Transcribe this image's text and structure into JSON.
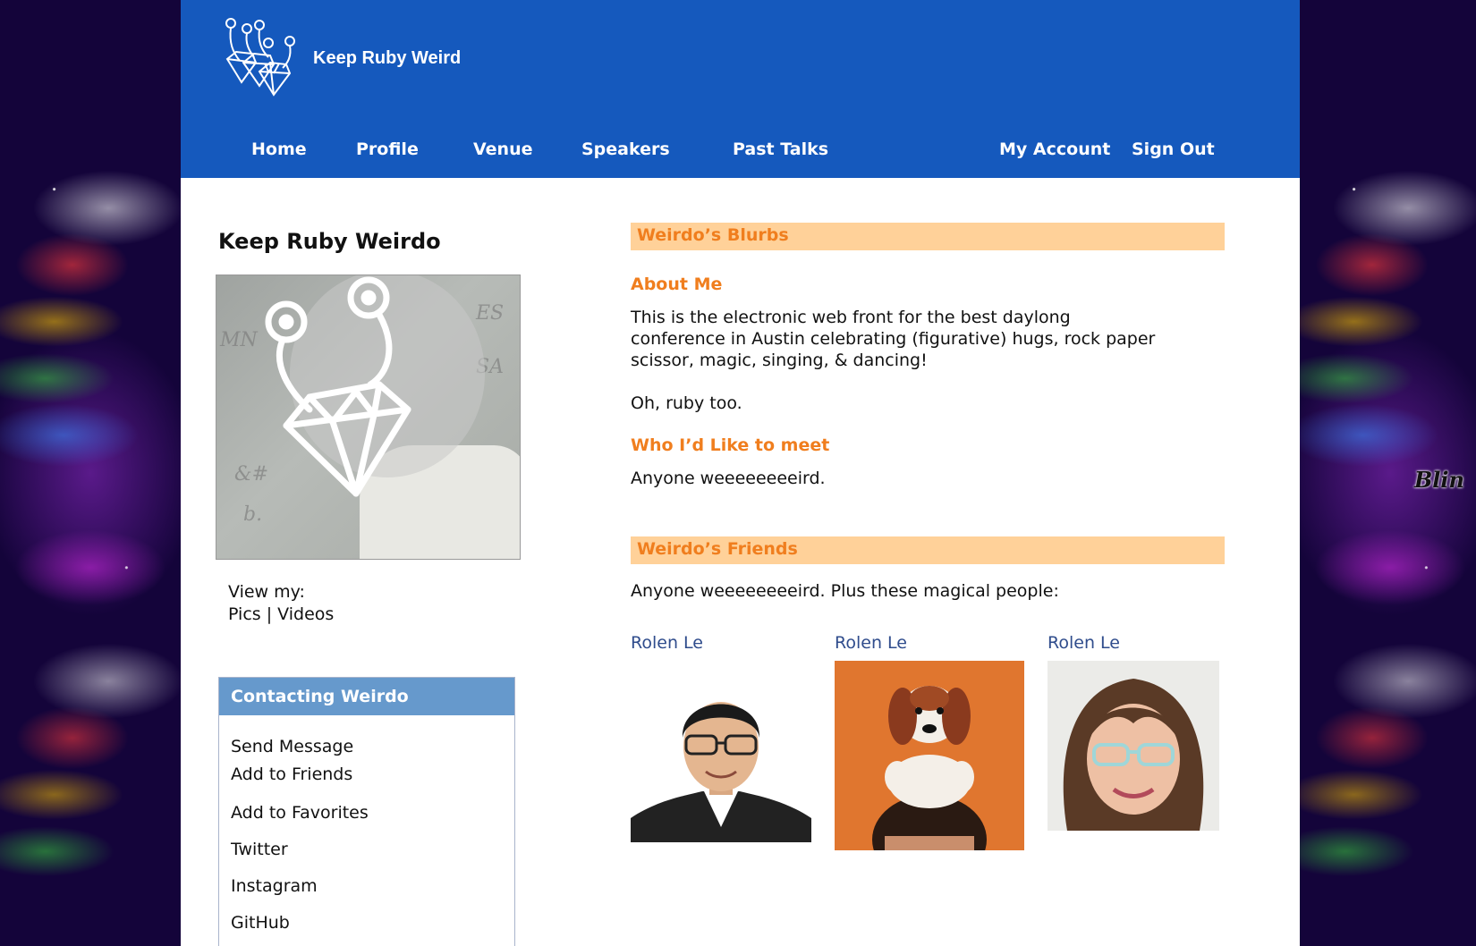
{
  "site": {
    "title": "Keep Ruby Weird",
    "brand_color": "#1559bd"
  },
  "nav": {
    "left": [
      "Home",
      "Profile",
      "Venue",
      "Speakers",
      "Past Talks"
    ],
    "right": [
      "My Account",
      "Sign Out"
    ]
  },
  "profile": {
    "name": "Keep Ruby Weirdo",
    "view_my_label": "View my:",
    "pics_link": "Pics",
    "separator": " | ",
    "videos_link": "Videos"
  },
  "contact": {
    "title": "Contacting Weirdo",
    "items": [
      "Send Message",
      "Add to Friends",
      "Add to Favorites",
      "Twitter",
      "Instagram",
      "GitHub"
    ]
  },
  "blurbs": {
    "title": "Weirdo’s Blurbs",
    "about_heading": "About Me",
    "about_text": "This is the electronic web front for the best daylong conference in Austin celebrating (figurative) hugs, rock paper scissor, magic, singing, & dancing!",
    "about_text2": "Oh, ruby too.",
    "meet_heading": "Who I’d Like to meet",
    "meet_text": "Anyone weeeeeeeeird."
  },
  "friends": {
    "title": "Weirdo’s Friends",
    "intro": "Anyone weeeeeeeeird. Plus these magical people:",
    "people": [
      {
        "name": "Rolen Le"
      },
      {
        "name": "Rolen Le"
      },
      {
        "name": "Rolen Le"
      }
    ]
  },
  "colors": {
    "section_bar": "#ffd199",
    "section_text": "#f07e1e",
    "contact_header": "#6699cc",
    "link": "#2f4c8c"
  },
  "icons": [
    "ruby-monster-logo-icon",
    "ruby-monster-avatar-icon"
  ]
}
